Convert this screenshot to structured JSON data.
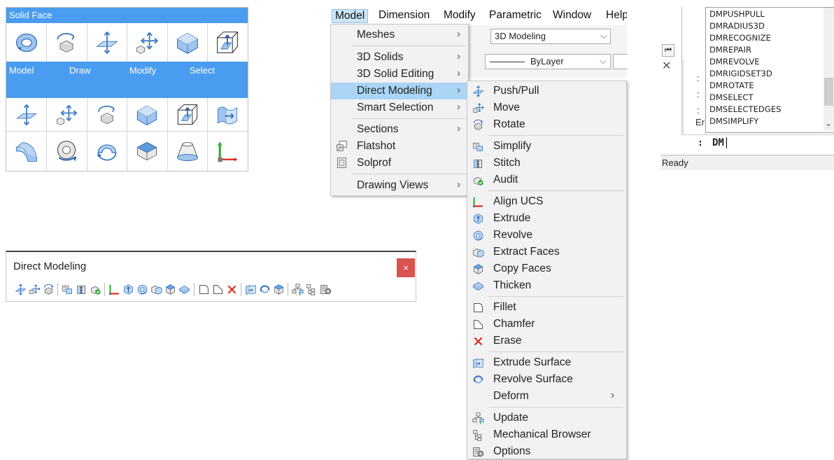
{
  "quad": {
    "title": "Solid Face",
    "tabs": [
      "Model",
      "Draw",
      "Modify",
      "Select"
    ]
  },
  "toolbar_window": {
    "title": "Direct Modeling",
    "close_label": "×"
  },
  "menubar": {
    "items": [
      "Model",
      "Dimension",
      "Modify",
      "Parametric",
      "Window",
      "Help"
    ]
  },
  "background_toolbar": {
    "workspace": "3D Modeling",
    "linetype": "ByLayer"
  },
  "model_menu": {
    "items": [
      {
        "label": "Meshes",
        "submenu": true
      },
      {
        "label": "3D Solids",
        "submenu": true
      },
      {
        "label": "3D Solid Editing",
        "submenu": true
      },
      {
        "label": "Direct Modeling",
        "submenu": true,
        "highlighted": true
      },
      {
        "label": "Smart Selection",
        "submenu": true
      },
      {
        "label": "Sections",
        "submenu": true
      },
      {
        "label": "Flatshot",
        "submenu": false
      },
      {
        "label": "Solprof",
        "submenu": false
      },
      {
        "label": "Drawing Views",
        "submenu": true
      }
    ]
  },
  "dm_menu": {
    "items": [
      {
        "label": "Push/Pull",
        "icon": "push-pull-icon"
      },
      {
        "label": "Move",
        "icon": "move-icon"
      },
      {
        "label": "Rotate",
        "icon": "rotate-icon"
      },
      {
        "label": "Simplify",
        "icon": "simplify-icon"
      },
      {
        "label": "Stitch",
        "icon": "stitch-icon"
      },
      {
        "label": "Audit",
        "icon": "audit-icon"
      },
      {
        "label": "Align UCS",
        "icon": "align-ucs-icon"
      },
      {
        "label": "Extrude",
        "icon": "extrude-icon"
      },
      {
        "label": "Revolve",
        "icon": "revolve-icon"
      },
      {
        "label": "Extract Faces",
        "icon": "extract-faces-icon"
      },
      {
        "label": "Copy Faces",
        "icon": "copy-faces-icon"
      },
      {
        "label": "Thicken",
        "icon": "thicken-icon"
      },
      {
        "label": "Fillet",
        "icon": "fillet-icon"
      },
      {
        "label": "Chamfer",
        "icon": "chamfer-icon"
      },
      {
        "label": "Erase",
        "icon": "erase-icon"
      },
      {
        "label": "Extrude Surface",
        "icon": "extrude-surface-icon"
      },
      {
        "label": "Revolve Surface",
        "icon": "revolve-surface-icon"
      },
      {
        "label": "Deform",
        "icon": "",
        "submenu": true
      },
      {
        "label": "Update",
        "icon": "update-icon"
      },
      {
        "label": "Mechanical Browser",
        "icon": "mechanical-browser-icon"
      },
      {
        "label": "Options",
        "icon": "options-icon"
      }
    ]
  },
  "command_window": {
    "suggestions": [
      "DMPUSHPULL",
      "DMRADIUS3D",
      "DMRECOGNIZE",
      "DMREPAIR",
      "DMREVOLVE",
      "DMRIGIDSET3D",
      "DMROTATE",
      "DMSELECT",
      "DMSELECTEDGES",
      "DMSIMPLIFY"
    ],
    "prompt_prefix": ":",
    "input_value": "DM",
    "status": "Ready",
    "partial_label": "Er"
  },
  "colors": {
    "accent": "#4a9cf0",
    "menu_highlight": "#aad5f5",
    "icon_blue": "#3a78c2",
    "close_red": "#d9534f",
    "erase_red": "#e0241b"
  }
}
